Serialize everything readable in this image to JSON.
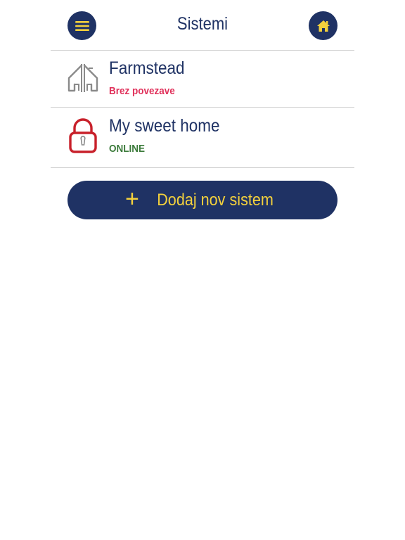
{
  "header": {
    "title": "Sistemi",
    "menu_icon": "hamburger-menu-icon",
    "home_icon": "house-icon"
  },
  "systems": [
    {
      "name": "Farmstead",
      "status": "Brez povezave",
      "status_color": "#e0305a",
      "icon": "house-outline-icon"
    },
    {
      "name": "My sweet home",
      "status": "ONLINE",
      "status_color": "#3b7a3a",
      "icon": "padlock-icon"
    }
  ],
  "add_button": {
    "label": "Dodaj nov sistem",
    "icon": "+"
  },
  "colors": {
    "primary": "#1f3264",
    "accent": "#f4d13c",
    "offline": "#e0305a",
    "online": "#3b7a3a"
  }
}
